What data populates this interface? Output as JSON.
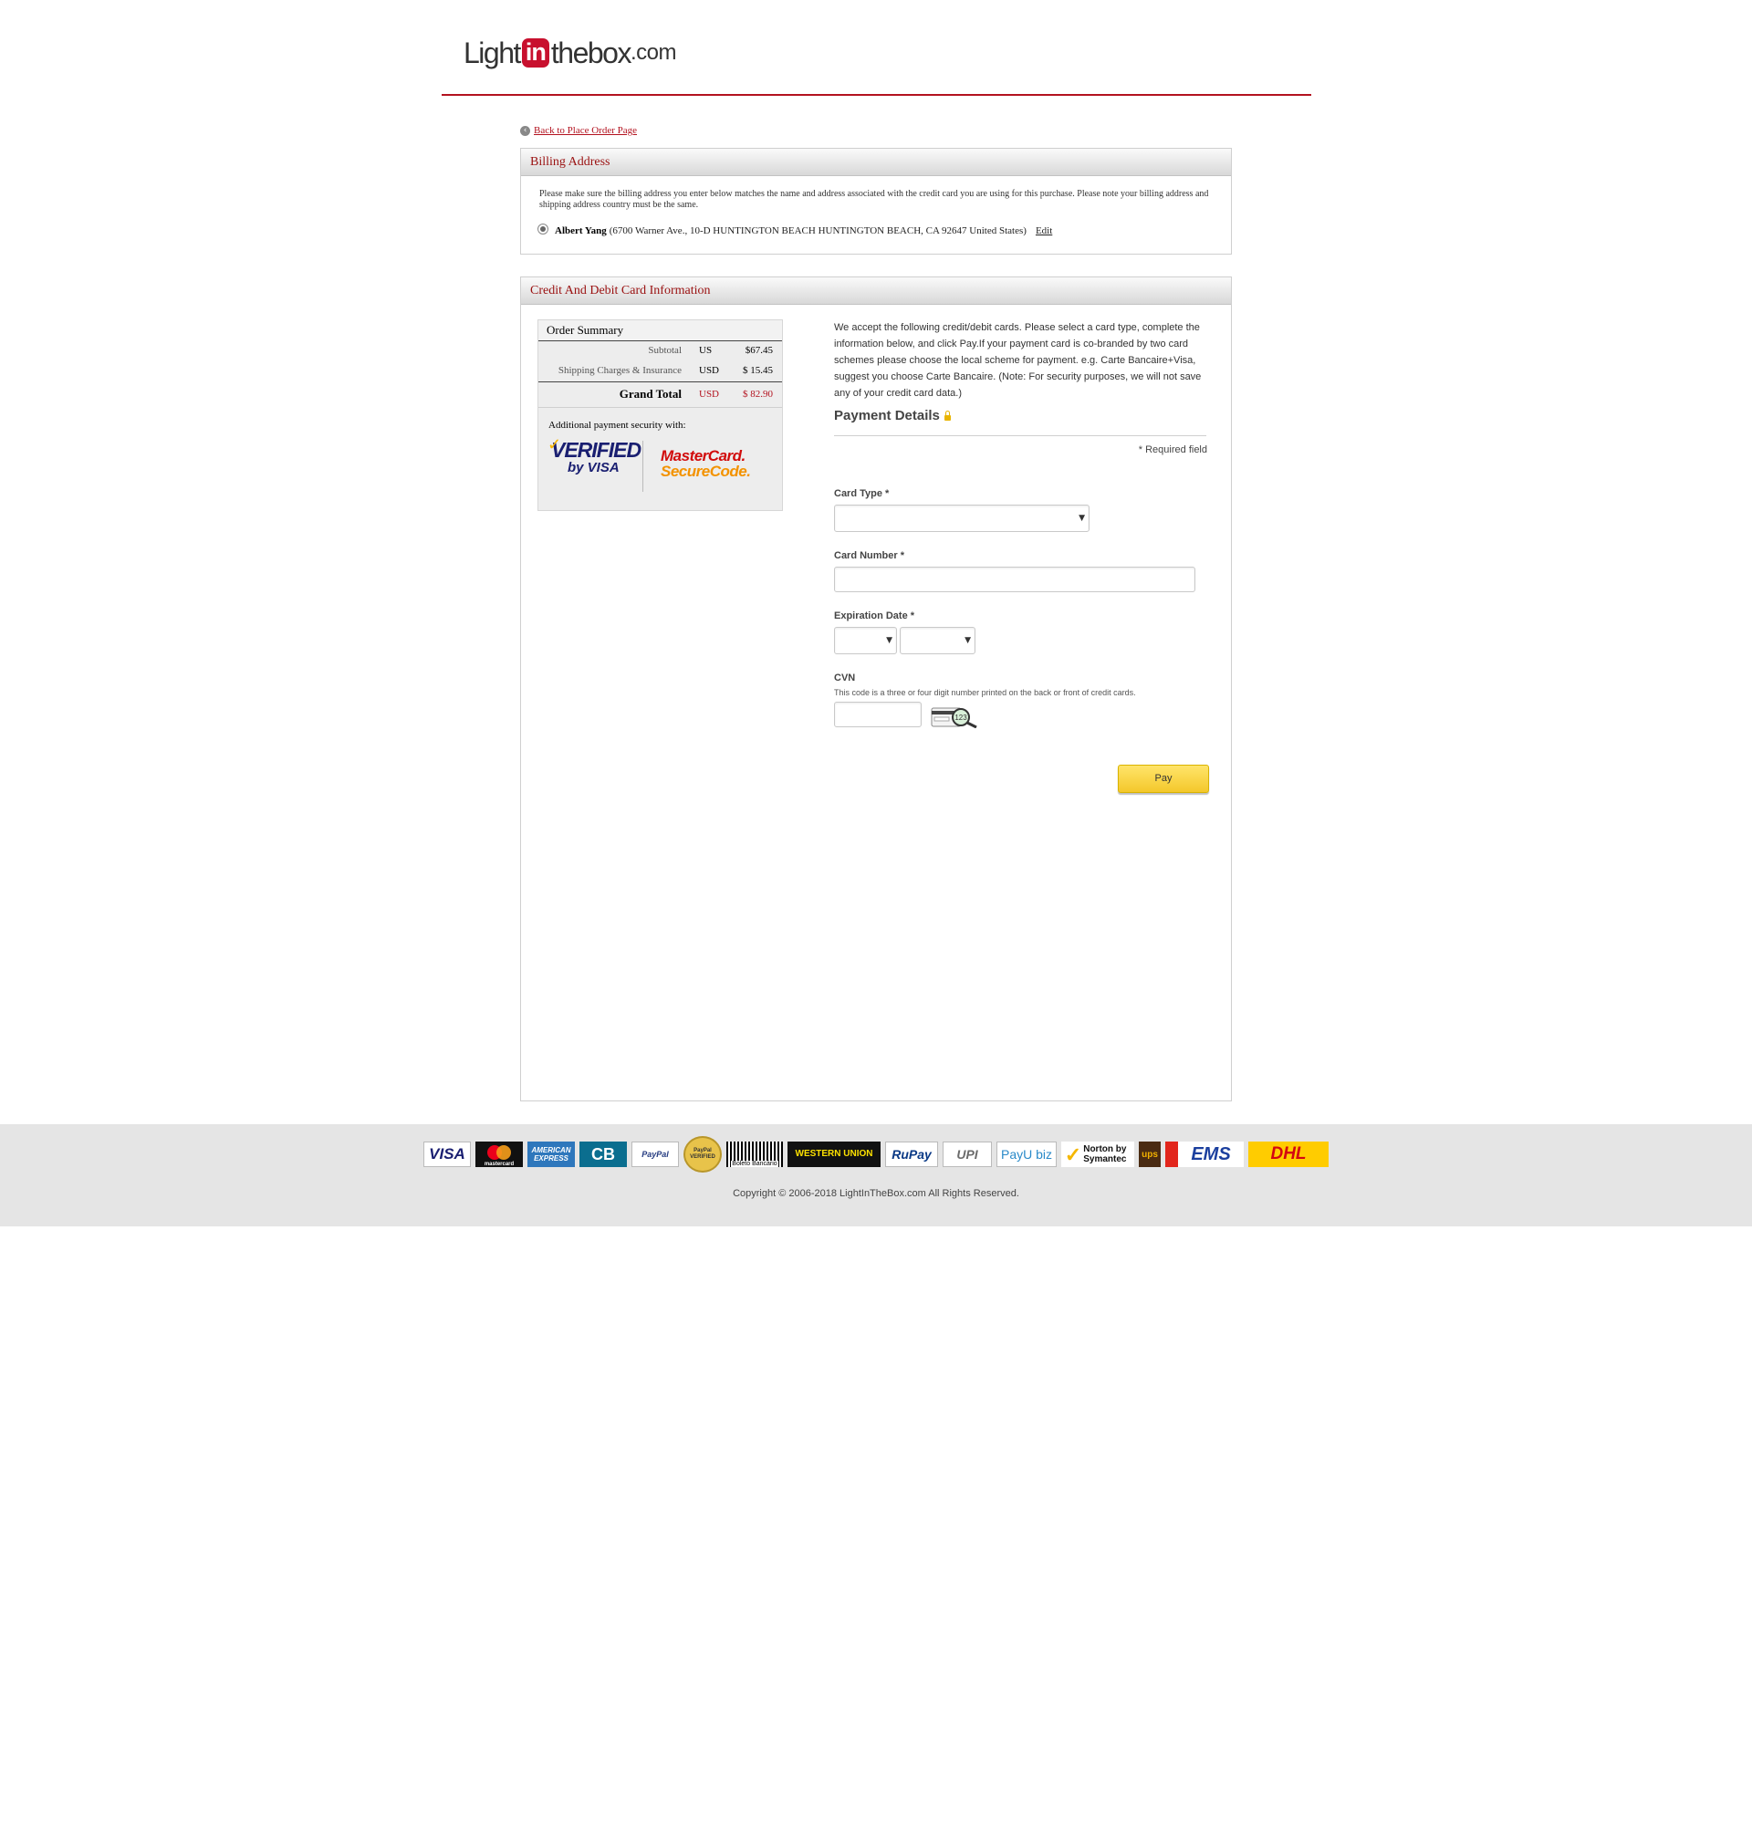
{
  "logo": {
    "part1": "Light",
    "part2": "in",
    "part3": "the",
    "part4": "box",
    "part5": ".com"
  },
  "back_link": "Back to Place Order Page",
  "billing": {
    "title": "Billing Address",
    "note": "Please make sure the billing address you enter below matches the name and address associated with the credit card you are using for this purchase. Please note your billing address and shipping address country must be the same.",
    "name": "Albert Yang",
    "address": "(6700 Warner Ave., 10-D HUNTINGTON BEACH HUNTINGTON BEACH, CA 92647 United States)",
    "edit": "Edit"
  },
  "card_section": {
    "title": "Credit And Debit Card Information",
    "order_summary": {
      "title": "Order Summary",
      "rows": [
        {
          "label": "Subtotal",
          "currency": "US",
          "value": "$67.45"
        },
        {
          "label": "Shipping Charges & Insurance",
          "currency": "USD",
          "value": "$ 15.45"
        }
      ],
      "grand_total": {
        "label": "Grand Total",
        "currency": "USD",
        "value": "$ 82.90"
      },
      "security_text": "Additional payment security with:",
      "vbv": {
        "line1": "VERIFIED",
        "line2": "by VISA"
      },
      "mcsc": {
        "line1": "MasterCard.",
        "line2": "SecureCode."
      }
    },
    "intro": "We accept the following credit/debit cards. Please select a card type, complete the information below, and click Pay.If your payment card is co-branded by two card schemes please choose the local scheme for payment. e.g. Carte Bancaire+Visa, suggest you choose Carte Bancaire. (Note: For security purposes, we will not save any of your credit card data.)",
    "payment_details": "Payment Details",
    "required_note": "* Required field",
    "card_type_label": "Card Type *",
    "card_type_value": "",
    "card_number_label": "Card Number *",
    "card_number_value": "",
    "expiration_label": "Expiration Date *",
    "exp_month_value": "",
    "exp_year_value": "",
    "cvn_label": "CVN",
    "cvn_help": "This code is a three or four digit number printed on the back or front of credit cards.",
    "cvn_value": "",
    "cvn_image_text": "123",
    "pay_button": "Pay"
  },
  "footer": {
    "logos": [
      "VISA",
      "mastercard",
      "AMERICAN EXPRESS",
      "CB",
      "PayPal",
      "PayPal VERIFIED",
      "Boleto Bancário",
      "WESTERN UNION",
      "RuPay",
      "UPI",
      "PayU biz",
      "Norton by Symantec",
      "ups",
      "EMS",
      "DHL"
    ],
    "copyright": "Copyright © 2006-2018 LightInTheBox.com All Rights Reserved."
  },
  "colors": {
    "brand_red": "#b3121f",
    "pay_button": "#f4c82b",
    "footer_bg": "#e5e5e5"
  }
}
